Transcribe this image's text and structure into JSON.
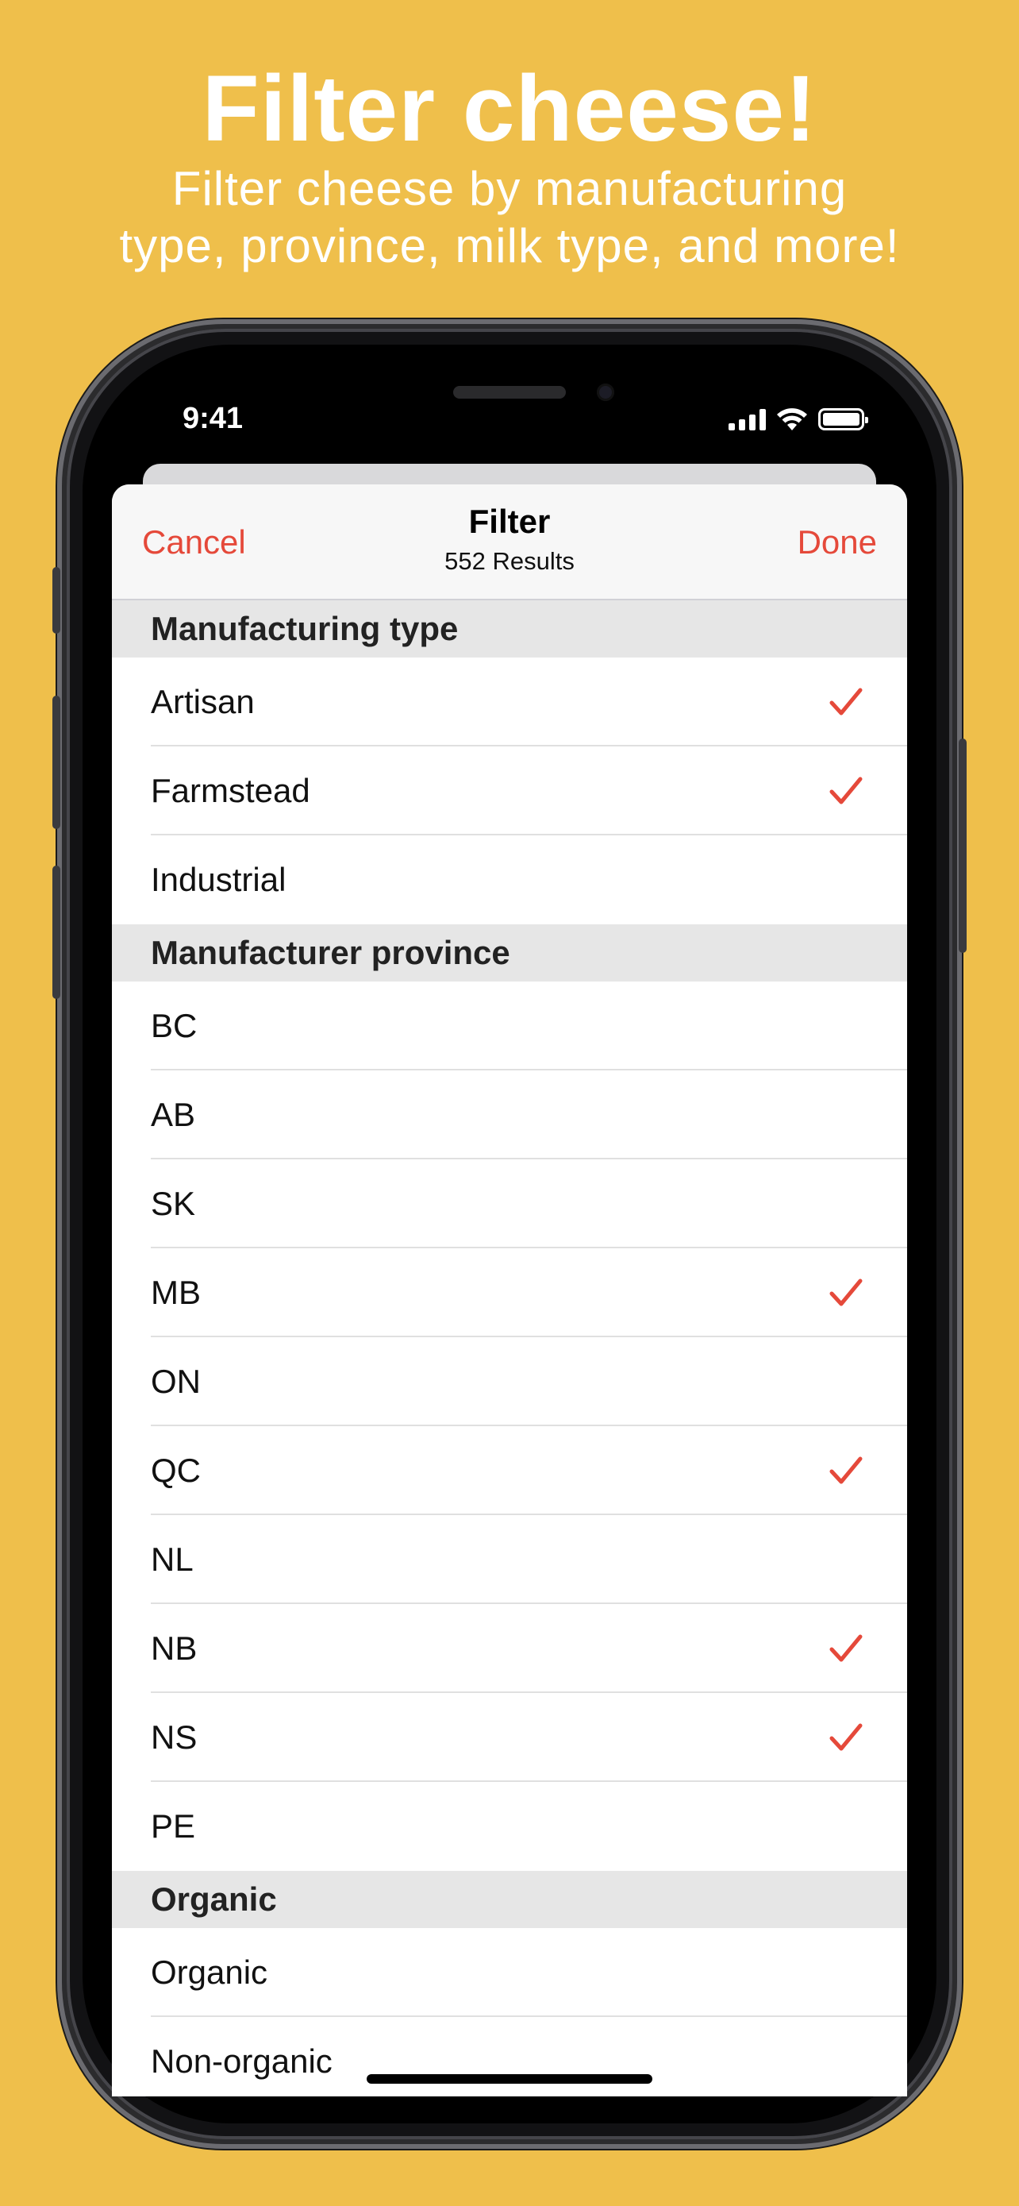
{
  "promo": {
    "title": "Filter cheese!",
    "subtitle_line1": "Filter cheese by manufacturing",
    "subtitle_line2": "type, province, milk type, and more!"
  },
  "status_bar": {
    "time": "9:41",
    "icons": [
      "cellular-signal-icon",
      "wifi-icon",
      "battery-icon"
    ]
  },
  "nav": {
    "cancel_label": "Cancel",
    "title": "Filter",
    "subtitle": "552 Results",
    "done_label": "Done"
  },
  "colors": {
    "background": "#EFBF4B",
    "accent": "#E5493A"
  },
  "sections": [
    {
      "header": "Manufacturing type",
      "rows": [
        {
          "label": "Artisan",
          "checked": true
        },
        {
          "label": "Farmstead",
          "checked": true
        },
        {
          "label": "Industrial",
          "checked": false
        }
      ]
    },
    {
      "header": "Manufacturer province",
      "rows": [
        {
          "label": "BC",
          "checked": false
        },
        {
          "label": "AB",
          "checked": false
        },
        {
          "label": "SK",
          "checked": false
        },
        {
          "label": "MB",
          "checked": true
        },
        {
          "label": "ON",
          "checked": false
        },
        {
          "label": "QC",
          "checked": true
        },
        {
          "label": "NL",
          "checked": false
        },
        {
          "label": "NB",
          "checked": true
        },
        {
          "label": "NS",
          "checked": true
        },
        {
          "label": "PE",
          "checked": false
        }
      ]
    },
    {
      "header": "Organic",
      "rows": [
        {
          "label": "Organic",
          "checked": false
        },
        {
          "label": "Non-organic",
          "checked": false
        }
      ]
    }
  ]
}
